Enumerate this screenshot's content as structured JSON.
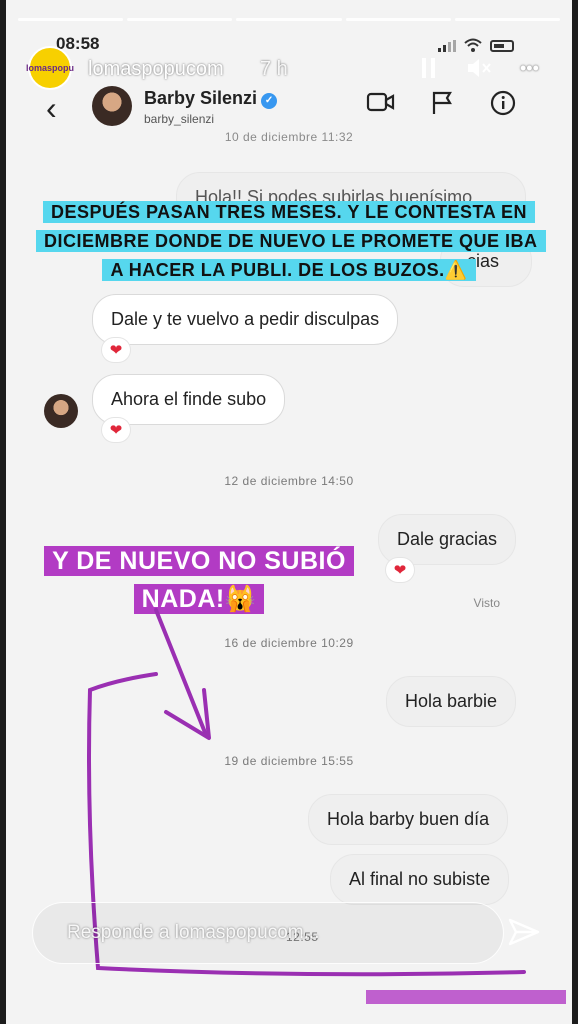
{
  "status_bar": {
    "time": "08:58"
  },
  "story": {
    "username": "lomaspopucom",
    "age": "7 h",
    "avatar_text": "lomaspopu",
    "pause_icon": "pause-icon",
    "mute_icon": "mute-icon",
    "more_label": "•••"
  },
  "dm_header": {
    "name": "Barby Silenzi",
    "handle": "barby_silenzi",
    "back_label": "‹"
  },
  "timestamps": [
    "10 de diciembre 11:32",
    "12 de diciembre 14:50",
    "16 de diciembre 10:29",
    "19 de diciembre 15:55",
    "12:55"
  ],
  "messages": {
    "partial_top": "Hola!! Si podes subirlas buenísimo",
    "partial_gracias": "cias",
    "dale_disculpas": "Dale y te vuelvo a pedir disculpas",
    "ahora_finde": "Ahora el finde subo",
    "dale_gracias": "Dale gracias",
    "hola_barbie": "Hola barbie",
    "hola_barby": "Hola barby buen día",
    "al_final": "Al final no subiste",
    "seen": "Visto"
  },
  "captions": {
    "cyan": "DESPUÉS PASAN TRES MESES. Y LE CONTESTA EN DICIEMBRE DONDE DE NUEVO LE PROMETE QUE IBA A HACER LA PUBLI. DE LOS BUZOS.⚠️",
    "purple": "Y DE NUEVO NO SUBIÓ NADA!🙀"
  },
  "reply": {
    "placeholder": "Responde a lomaspopucom..."
  },
  "colors": {
    "cyan": "#56d7ee",
    "purple": "#b23bc4",
    "heart": "#e0263a",
    "verified": "#3797f0"
  }
}
